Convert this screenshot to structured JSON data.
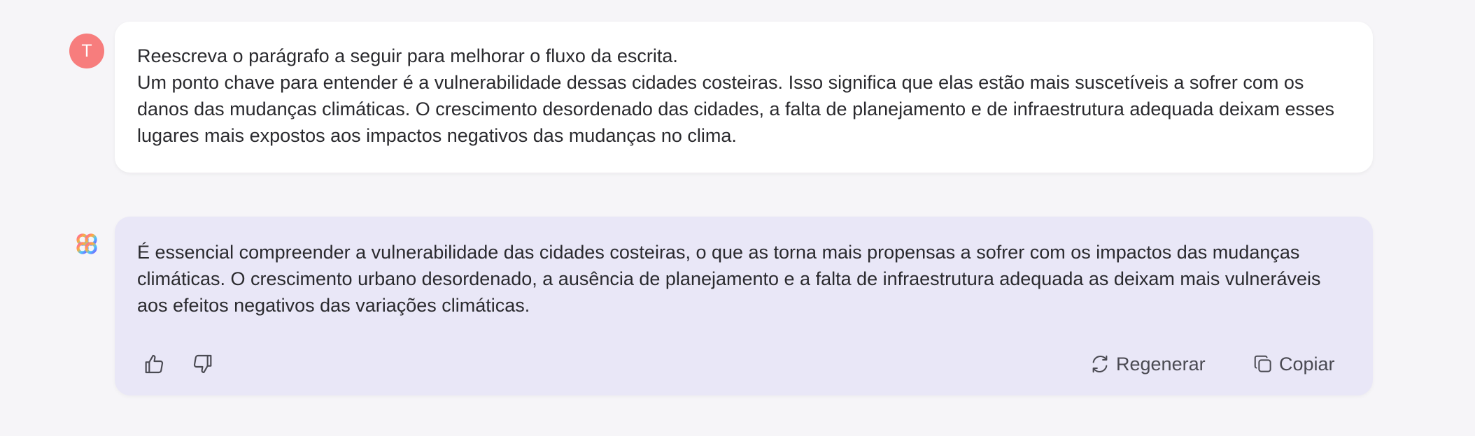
{
  "user_message": {
    "avatar_letter": "T",
    "lines": [
      "Reescreva o parágrafo a seguir para melhorar o fluxo da escrita.",
      "Um ponto chave para entender é a vulnerabilidade dessas cidades costeiras. Isso significa que elas estão mais suscetíveis a sofrer com os danos das mudanças climáticas. O crescimento desordenado das cidades, a falta de planejamento e de infraestrutura adequada deixam esses lugares mais expostos aos impactos negativos das mudanças no clima."
    ]
  },
  "assistant_message": {
    "logo_icon": "assistant-logo-icon",
    "text": "É essencial compreender a vulnerabilidade das cidades costeiras, o que as torna mais propensas a sofrer com os impactos das mudanças climáticas. O crescimento urbano desordenado, a ausência de planejamento e a falta de infraestrutura adequada as deixam mais vulneráveis aos efeitos negativos das variações climáticas.",
    "actions": {
      "like_icon": "thumbs-up-icon",
      "dislike_icon": "thumbs-down-icon",
      "regenerate_label": "Regenerar",
      "regenerate_icon": "refresh-icon",
      "copy_label": "Copiar",
      "copy_icon": "copy-icon"
    }
  },
  "colors": {
    "background": "#f6f5f8",
    "user_avatar": "#f77d7d",
    "user_bubble": "#ffffff",
    "assistant_bubble": "#e9e7f7"
  }
}
